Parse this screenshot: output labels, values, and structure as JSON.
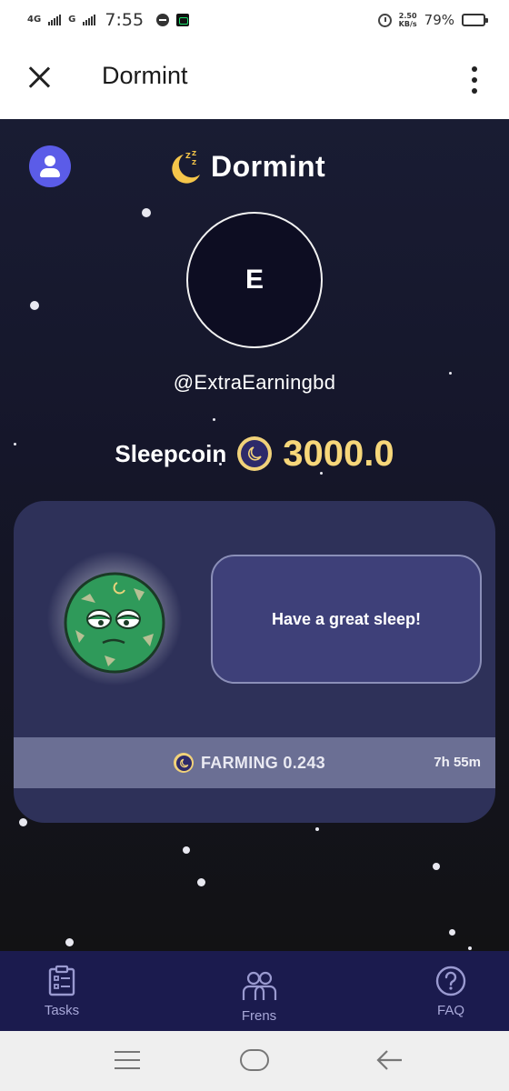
{
  "status_bar": {
    "network_1": "4G",
    "network_2": "G",
    "time": "7:55",
    "speed_value": "2.50",
    "speed_unit": "KB/s",
    "battery_pct": "79%",
    "battery_level": 0.79
  },
  "app_bar": {
    "title": "Dormint"
  },
  "header": {
    "brand_name": "Dormint"
  },
  "profile": {
    "avatar_letter": "E",
    "username": "@ExtraEarningbd"
  },
  "balance": {
    "label": "Sleepcoin",
    "value": "3000.0"
  },
  "card": {
    "message": "Have a great sleep!",
    "farming_text": "FARMING 0.243",
    "timer": "7h 55m"
  },
  "bottom_nav": {
    "items": [
      {
        "label": "Tasks",
        "icon": "tasks-clipboard-icon"
      },
      {
        "label": "Frens",
        "icon": "friends-icon"
      },
      {
        "label": "FAQ",
        "icon": "question-icon"
      }
    ]
  },
  "colors": {
    "accent_gold": "#f7d77a",
    "profile_button": "#5b5ce8",
    "card_bg": "#2e3159",
    "nav_bg": "#1b1b4e"
  }
}
